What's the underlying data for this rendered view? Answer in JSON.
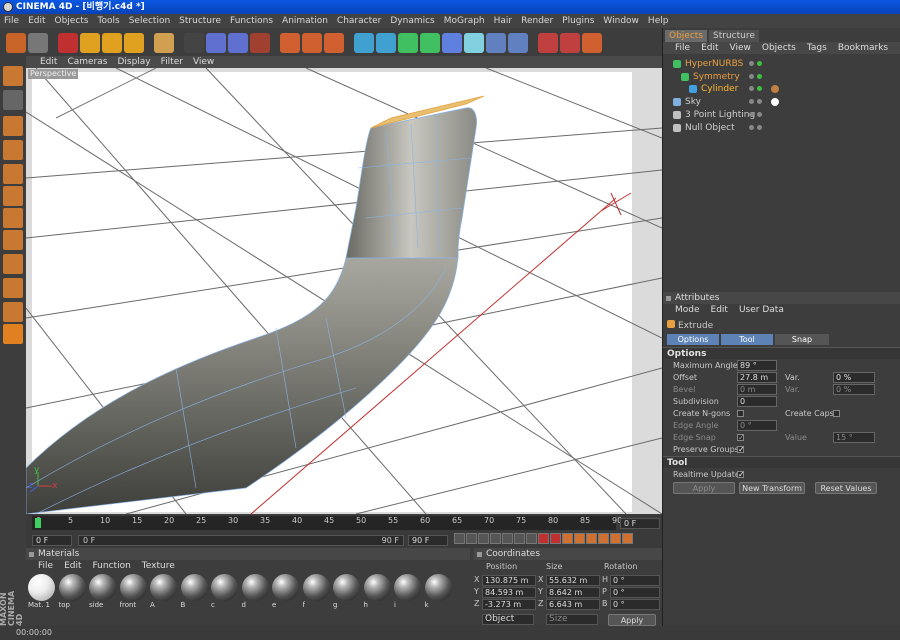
{
  "window": {
    "app": "CINEMA 4D",
    "title": "CINEMA 4D - [비행기.c4d *]"
  },
  "menu": [
    "File",
    "Edit",
    "Objects",
    "Tools",
    "Selection",
    "Structure",
    "Functions",
    "Animation",
    "Character",
    "Dynamics",
    "MoGraph",
    "Hair",
    "Render",
    "Plugins",
    "Window",
    "Help"
  ],
  "toolbar_icons": [
    "undo-icon",
    "redo-icon",
    "live-select-icon",
    "move-icon",
    "scale-icon",
    "rotate-icon",
    "model-mode-icon",
    "x-axis-icon",
    "y-axis-icon",
    "z-axis-icon",
    "coordinate-system-icon",
    "render-view-icon",
    "render-picture-viewer-icon",
    "render-settings-icon",
    "cube-icon",
    "nurbs-icon",
    "spline-icon",
    "array-icon",
    "deformer-icon",
    "scene-icon",
    "light-icon",
    "camera-icon",
    "help-icon",
    "material-manager-icon",
    "web-icon"
  ],
  "viewport": {
    "menu": [
      "Edit",
      "Cameras",
      "Display",
      "Filter",
      "View"
    ],
    "label": "Perspective"
  },
  "objects": {
    "tabs": [
      "Objects",
      "Structure"
    ],
    "menu": [
      "File",
      "Edit",
      "View",
      "Objects",
      "Tags",
      "Bookmarks"
    ],
    "items": [
      {
        "name": "HyperNURBS",
        "depth": 0,
        "color": "#e8a040"
      },
      {
        "name": "Symmetry",
        "depth": 1,
        "color": "#e8a040"
      },
      {
        "name": "Cylinder",
        "depth": 2,
        "color": "#ffb830"
      },
      {
        "name": "Sky",
        "depth": 0,
        "color": "#cfcfcf"
      },
      {
        "name": "3 Point Lighting",
        "depth": 0,
        "color": "#cfcfcf"
      },
      {
        "name": "Null Object",
        "depth": 0,
        "color": "#cfcfcf"
      }
    ]
  },
  "attributes": {
    "title": "Attributes",
    "menu": [
      "Mode",
      "Edit",
      "User Data"
    ],
    "tool_name": "Extrude",
    "tabs": [
      "Options",
      "Tool",
      "Snap Settings"
    ],
    "options_header": "Options",
    "max_angle_label": "Maximum Angle",
    "max_angle_value": "89 °",
    "offset_label": "Offset",
    "offset_value": "27.8 m",
    "var_label": "Var.",
    "var_value": "0 %",
    "bevel_label": "Bevel",
    "bevel_value": "0 m",
    "var2_value": "0 %",
    "subdivision_label": "Subdivision",
    "subdivision_value": "0",
    "create_ngons_label": "Create N-gons",
    "create_caps_label": "Create Caps",
    "edge_angle_label": "Edge Angle",
    "edge_angle_value": "0 °",
    "edge_snap_label": "Edge Snap",
    "value_label": "Value",
    "value_value": "15 °",
    "preserve_groups_label": "Preserve Groups",
    "tool_header": "Tool",
    "realtime_update_label": "Realtime Update",
    "apply_label": "Apply",
    "new_transform_label": "New Transform",
    "reset_values_label": "Reset Values"
  },
  "timeline": {
    "ticks": [
      "0",
      "5",
      "10",
      "15",
      "20",
      "25",
      "30",
      "35",
      "40",
      "45",
      "50",
      "55",
      "60",
      "65",
      "70",
      "75",
      "80",
      "85",
      "90"
    ],
    "current_frame_right": "0 F",
    "start_field": "0 F",
    "range_start": "0 F",
    "range_end": "90 F",
    "end_field": "90 F"
  },
  "materials": {
    "title": "Materials",
    "menu": [
      "File",
      "Edit",
      "Function",
      "Texture"
    ],
    "items": [
      "Mat. 1",
      "top",
      "side",
      "front",
      "A",
      "B",
      "c",
      "d",
      "e",
      "f",
      "g",
      "h",
      "i",
      "k"
    ]
  },
  "coordinates": {
    "title": "Coordinates",
    "col_position": "Position",
    "col_size": "Size",
    "col_rotation": "Rotation",
    "rows": [
      {
        "axis": "X",
        "pos": "130.875 m",
        "saxis": "X",
        "size": "55.632 m",
        "raxis": "H",
        "rot": "0 °"
      },
      {
        "axis": "Y",
        "pos": "84.593 m",
        "saxis": "Y",
        "size": "8.642 m",
        "raxis": "P",
        "rot": "0 °"
      },
      {
        "axis": "Z",
        "pos": "-3.273 m",
        "saxis": "Z",
        "size": "6.643 m",
        "raxis": "B",
        "rot": "0 °"
      }
    ],
    "mode_select": "Object",
    "size_select": "Size",
    "apply_label": "Apply"
  },
  "status": {
    "time": "00:00:00"
  },
  "brand": "MAXON CINEMA 4D",
  "axis_gizmo": {
    "x": "x",
    "y": "y",
    "z": "z"
  }
}
